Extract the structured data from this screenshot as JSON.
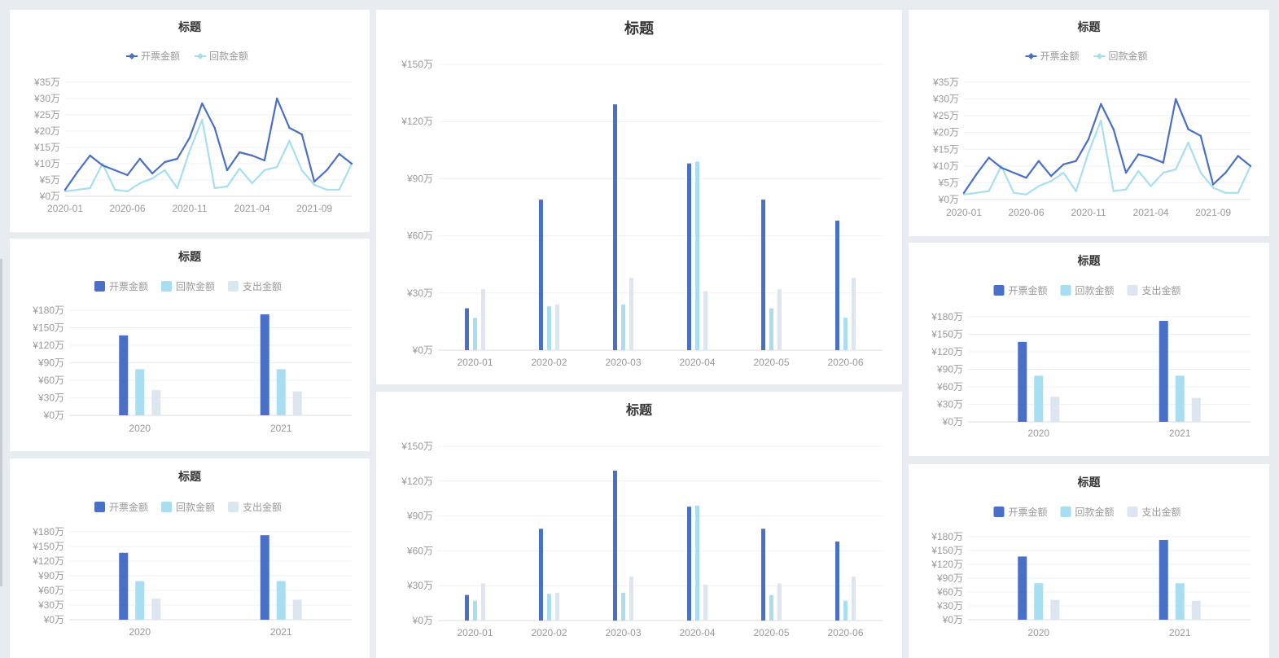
{
  "colors": {
    "invoice": "#4a6fc7",
    "payment": "#a8def0",
    "expense": "#dde6ef",
    "grid": "#eef0f3",
    "axis": "#d9dde3",
    "text": "#999999",
    "title": "#333333"
  },
  "charts": [
    {
      "id": "line-left",
      "title": "标题",
      "legend_icon": "diamond-line",
      "chart_data": {
        "type": "line",
        "title": "标题",
        "x_labels": [
          "2020-01",
          "2020-06",
          "2020-11",
          "2021-04",
          "2021-09"
        ],
        "y_ticks": [
          "¥0万",
          "¥5万",
          "¥10万",
          "¥15万",
          "¥20万",
          "¥25万",
          "¥30万",
          "¥35万"
        ],
        "ylim": [
          0,
          35
        ],
        "grid": true,
        "legend": "top-center",
        "series": [
          {
            "name": "开票金额",
            "color": "#4a6fc7",
            "values": [
              2,
              7.5,
              12.5,
              9.5,
              8,
              6.5,
              11.5,
              7,
              10.5,
              11.5,
              18,
              28.5,
              21,
              8,
              13.5,
              12.5,
              11,
              30,
              21,
              19,
              4.5,
              8,
              13,
              10
            ]
          },
          {
            "name": "回款金额",
            "color": "#a8def0",
            "values": [
              1.5,
              2,
              2.5,
              10,
              2,
              1.5,
              4,
              5.5,
              8,
              2.5,
              14,
              23.5,
              2.5,
              3,
              8.5,
              4,
              8,
              9,
              17,
              8,
              3.5,
              2,
              2,
              10
            ]
          }
        ]
      }
    },
    {
      "id": "bar-big-top",
      "title": "标题",
      "chart_data": {
        "type": "bar",
        "title": "标题",
        "categories": [
          "2020-01",
          "2020-02",
          "2020-03",
          "2020-04",
          "2020-05",
          "2020-06"
        ],
        "y_ticks": [
          "¥0万",
          "¥30万",
          "¥60万",
          "¥90万",
          "¥120万",
          "¥150万"
        ],
        "ylim": [
          0,
          150
        ],
        "grid": true,
        "series": [
          {
            "name": "开票金额",
            "color": "#4a6fc7",
            "values": [
              22,
              79,
              129,
              98,
              79,
              68
            ]
          },
          {
            "name": "回款金额",
            "color": "#a8def0",
            "values": [
              17,
              23,
              24,
              99,
              22,
              17
            ]
          },
          {
            "name": "支出金额",
            "color": "#dde6ef",
            "values": [
              32,
              24,
              38,
              31,
              32,
              38
            ]
          }
        ]
      }
    },
    {
      "id": "line-right",
      "title": "标题",
      "legend_icon": "diamond-line",
      "chart_data": {
        "type": "line",
        "title": "标题",
        "x_labels": [
          "2020-01",
          "2020-06",
          "2020-11",
          "2021-04",
          "2021-09"
        ],
        "y_ticks": [
          "¥0万",
          "¥5万",
          "¥10万",
          "¥15万",
          "¥20万",
          "¥25万",
          "¥30万",
          "¥35万"
        ],
        "ylim": [
          0,
          35
        ],
        "grid": true,
        "legend": "top-center",
        "series": [
          {
            "name": "开票金额",
            "color": "#4a6fc7",
            "values": [
              2,
              7.5,
              12.5,
              9.5,
              8,
              6.5,
              11.5,
              7,
              10.5,
              11.5,
              18,
              28.5,
              21,
              8,
              13.5,
              12.5,
              11,
              30,
              21,
              19,
              4.5,
              8,
              13,
              10
            ]
          },
          {
            "name": "回款金额",
            "color": "#a8def0",
            "values": [
              1.5,
              2,
              2.5,
              10,
              2,
              1.5,
              4,
              5.5,
              8,
              2.5,
              14,
              23.5,
              2.5,
              3,
              8.5,
              4,
              8,
              9,
              17,
              8,
              3.5,
              2,
              2,
              10
            ]
          }
        ]
      }
    },
    {
      "id": "bar-left-mid",
      "title": "标题",
      "chart_data": {
        "type": "bar",
        "title": "标题",
        "categories": [
          "2020",
          "2021"
        ],
        "y_ticks": [
          "¥0万",
          "¥30万",
          "¥60万",
          "¥90万",
          "¥120万",
          "¥150万",
          "¥180万"
        ],
        "ylim": [
          0,
          180
        ],
        "grid": true,
        "legend": "top-center",
        "series": [
          {
            "name": "开票金额",
            "color": "#4a6fc7",
            "values": [
              137,
              173
            ]
          },
          {
            "name": "回款金额",
            "color": "#a8def0",
            "values": [
              79,
              79
            ]
          },
          {
            "name": "支出金额",
            "color": "#dde6ef",
            "values": [
              43,
              41
            ]
          }
        ]
      }
    },
    {
      "id": "bar-left-bottom",
      "title": "标题",
      "chart_data": {
        "type": "bar",
        "title": "标题",
        "categories": [
          "2020",
          "2021"
        ],
        "y_ticks": [
          "¥0万",
          "¥30万",
          "¥60万",
          "¥90万",
          "¥120万",
          "¥150万",
          "¥180万"
        ],
        "ylim": [
          0,
          180
        ],
        "grid": true,
        "legend": "top-center",
        "series": [
          {
            "name": "开票金额",
            "color": "#4a6fc7",
            "values": [
              137,
              173
            ]
          },
          {
            "name": "回款金额",
            "color": "#a8def0",
            "values": [
              79,
              79
            ]
          },
          {
            "name": "支出金额",
            "color": "#dde6ef",
            "values": [
              43,
              41
            ]
          }
        ]
      }
    },
    {
      "id": "bar-big-bottom",
      "title": "标题",
      "chart_data": {
        "type": "bar",
        "title": "标题",
        "categories": [
          "2020-01",
          "2020-02",
          "2020-03",
          "2020-04",
          "2020-05",
          "2020-06"
        ],
        "y_ticks": [
          "¥0万",
          "¥30万",
          "¥60万",
          "¥90万",
          "¥120万",
          "¥150万"
        ],
        "ylim": [
          0,
          150
        ],
        "grid": true,
        "series": [
          {
            "name": "开票金额",
            "color": "#4a6fc7",
            "values": [
              22,
              79,
              129,
              98,
              79,
              68
            ]
          },
          {
            "name": "回款金额",
            "color": "#a8def0",
            "values": [
              17,
              23,
              24,
              99,
              22,
              17
            ]
          },
          {
            "name": "支出金额",
            "color": "#dde6ef",
            "values": [
              32,
              24,
              38,
              31,
              32,
              38
            ]
          }
        ]
      }
    },
    {
      "id": "bar-right-mid",
      "title": "标题",
      "chart_data": {
        "type": "bar",
        "title": "标题",
        "categories": [
          "2020",
          "2021"
        ],
        "y_ticks": [
          "¥0万",
          "¥30万",
          "¥60万",
          "¥90万",
          "¥120万",
          "¥150万",
          "¥180万"
        ],
        "ylim": [
          0,
          180
        ],
        "grid": true,
        "legend": "top-center",
        "series": [
          {
            "name": "开票金额",
            "color": "#4a6fc7",
            "values": [
              137,
              173
            ]
          },
          {
            "name": "回款金额",
            "color": "#a8def0",
            "values": [
              79,
              79
            ]
          },
          {
            "name": "支出金额",
            "color": "#dde6ef",
            "values": [
              43,
              41
            ]
          }
        ]
      }
    },
    {
      "id": "bar-right-bottom",
      "title": "标题",
      "chart_data": {
        "type": "bar",
        "title": "标题",
        "categories": [
          "2020",
          "2021"
        ],
        "y_ticks": [
          "¥0万",
          "¥30万",
          "¥60万",
          "¥90万",
          "¥120万",
          "¥150万",
          "¥180万"
        ],
        "ylim": [
          0,
          180
        ],
        "grid": true,
        "legend": "top-center",
        "series": [
          {
            "name": "开票金额",
            "color": "#4a6fc7",
            "values": [
              137,
              173
            ]
          },
          {
            "name": "回款金额",
            "color": "#a8def0",
            "values": [
              79,
              79
            ]
          },
          {
            "name": "支出金额",
            "color": "#dde6ef",
            "values": [
              43,
              41
            ]
          }
        ]
      }
    }
  ]
}
